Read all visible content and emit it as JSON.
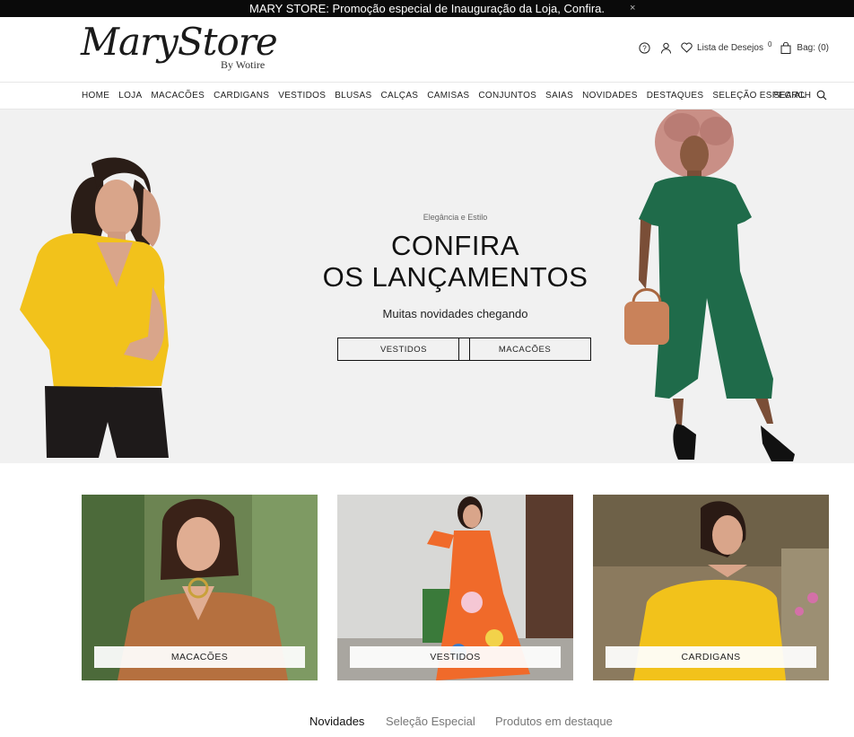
{
  "announcement": {
    "text": "MARY STORE: Promoção especial de Inauguração da Loja, Confira.",
    "close": "×"
  },
  "logo": {
    "name": "MaryStore",
    "by": "By Wotire"
  },
  "header": {
    "wishlist_label": "Lista de Desejos",
    "wishlist_count": "0",
    "bag_label": "Bag: (0)",
    "icons": [
      "help-icon",
      "user-icon",
      "heart-icon",
      "bag-icon"
    ]
  },
  "nav": {
    "items": [
      "HOME",
      "LOJA",
      "MACACÕES",
      "CARDIGANS",
      "VESTIDOS",
      "BLUSAS",
      "CALÇAS",
      "CAMISAS",
      "CONJUNTOS",
      "SAIAS",
      "NOVIDADES",
      "DESTAQUES",
      "SELEÇÃO ESPECIAL"
    ],
    "search_label": "SEARCH"
  },
  "hero": {
    "eyebrow": "Elegância e Estilo",
    "title_line1": "CONFIRA",
    "title_line2": "OS LANÇAMENTOS",
    "subtitle": "Muitas novidades chegando",
    "button1": "VESTIDOS",
    "button2": "MACACÕES"
  },
  "categories": [
    {
      "label": "MACACÕES"
    },
    {
      "label": "VESTIDOS"
    },
    {
      "label": "CARDIGANS"
    }
  ],
  "tabs": [
    "Novidades",
    "Seleção Especial",
    "Produtos em destaque"
  ],
  "colors": {
    "topbar": "#0a0a0a",
    "hero_bg": "#f1f1f1",
    "accent_yellow": "#f2c21b",
    "green_jumpsuit": "#1f6b4a"
  }
}
